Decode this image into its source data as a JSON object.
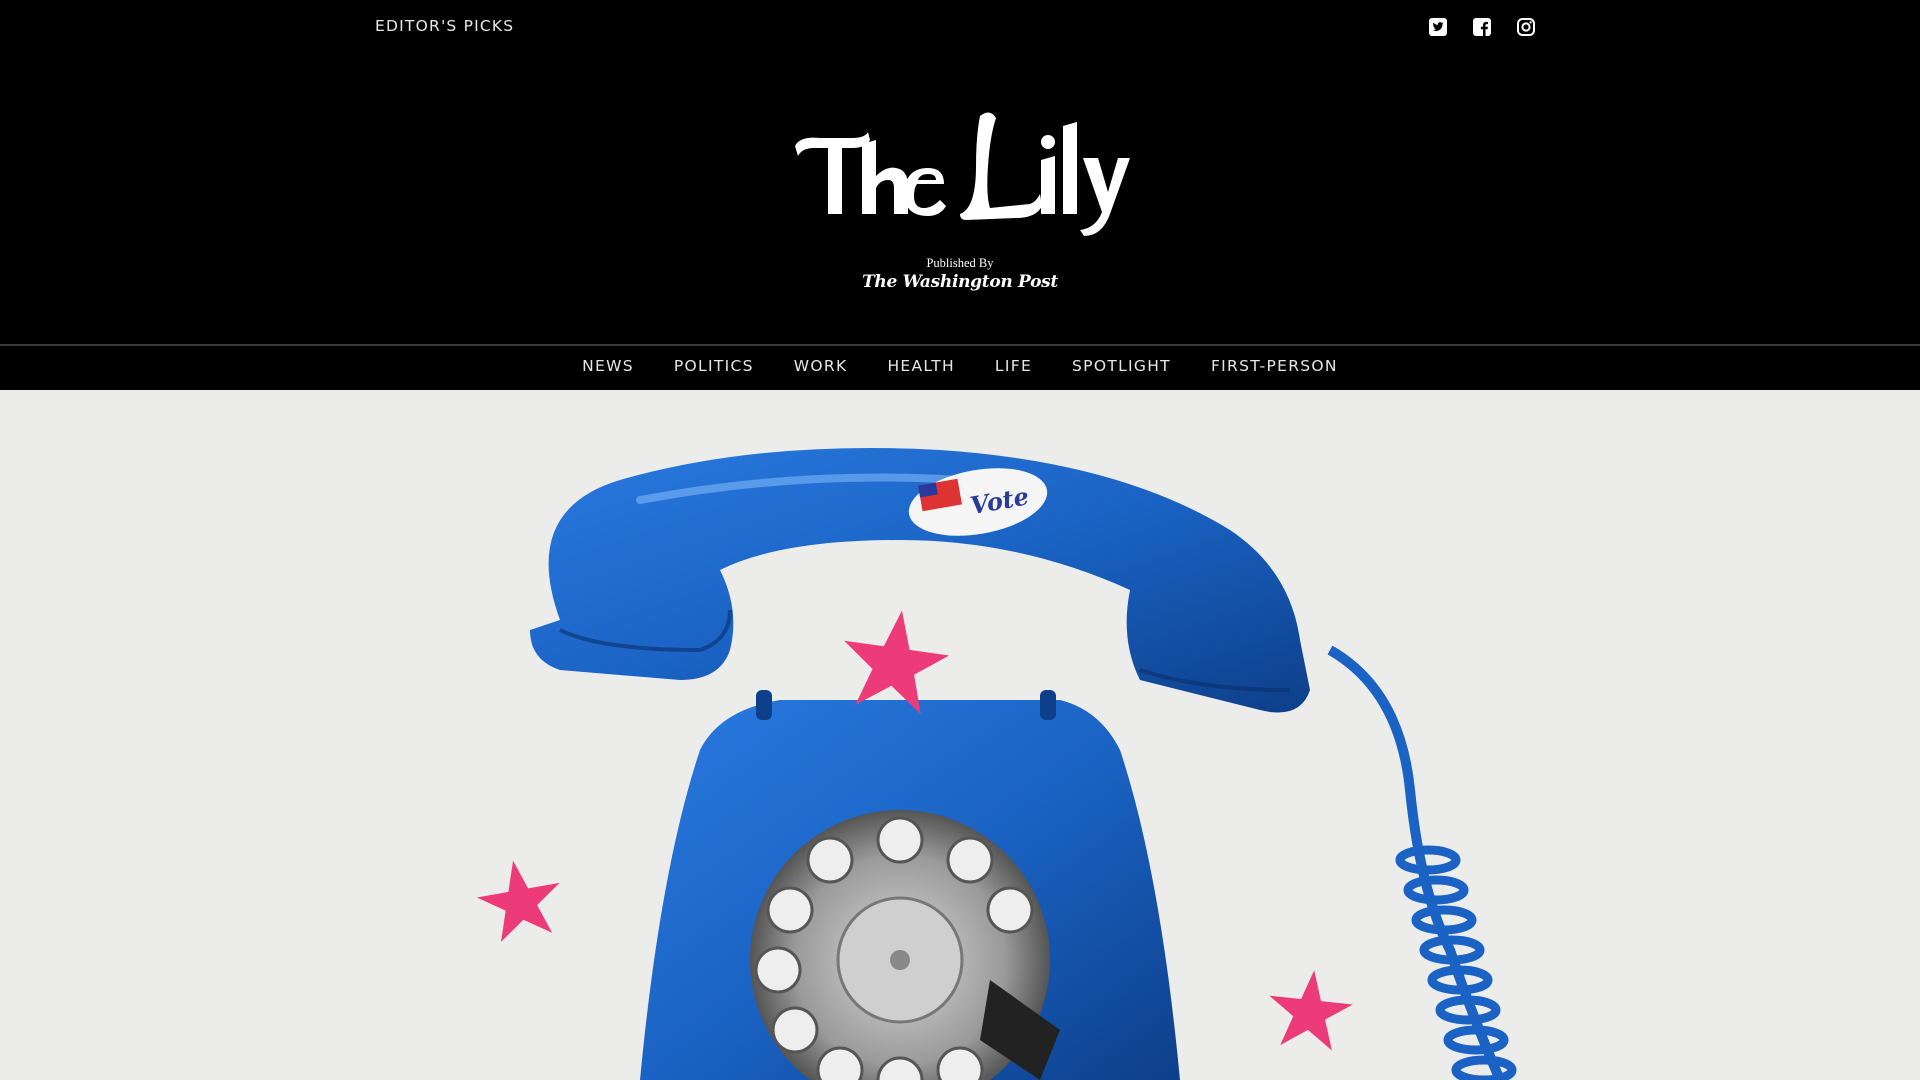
{
  "header": {
    "editors_picks": "EDITOR'S PICKS",
    "social": [
      {
        "name": "twitter-icon"
      },
      {
        "name": "facebook-icon"
      },
      {
        "name": "instagram-icon"
      }
    ]
  },
  "masthead": {
    "logo_text": "The Lily",
    "published_by": "Published By",
    "publisher": "The Washington Post"
  },
  "nav": {
    "items": [
      "NEWS",
      "POLITICS",
      "WORK",
      "HEALTH",
      "LIFE",
      "SPOTLIGHT",
      "FIRST-PERSON"
    ]
  },
  "hero": {
    "sticker_text": "Vote",
    "colors": {
      "phone_blue": "#1a63c4",
      "star_pink": "#ec3b78",
      "background": "#ececea"
    }
  }
}
